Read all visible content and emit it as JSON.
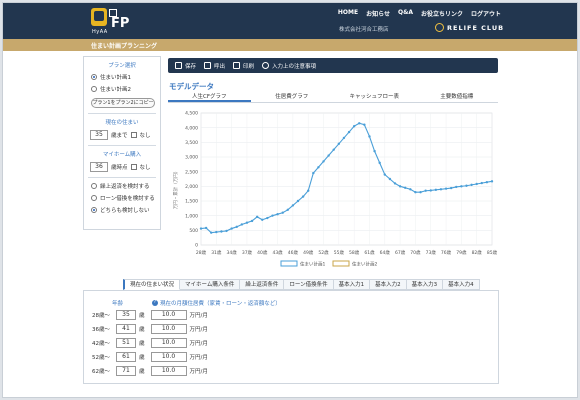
{
  "header": {
    "logo_text": "FP",
    "logo_tagline": "HyAA",
    "nav": [
      "HOME",
      "お知らせ",
      "Q&A",
      "お役立ちリンク",
      "ログアウト"
    ],
    "company": "株式会社河合工務店",
    "brand": "RELIFE CLUB"
  },
  "subbar": {
    "title": "住まい計画プランニング"
  },
  "sidebar": {
    "plan_heading": "プラン選択",
    "plans": [
      {
        "label": "住まい計画1",
        "selected": true
      },
      {
        "label": "住まい計画2",
        "selected": false
      }
    ],
    "copy_button": "プラン1をプラン2にコピー",
    "current_home_heading": "現在の住まい",
    "current_home_value": "35",
    "current_home_unit": "歳まで",
    "none_label": "なし",
    "myhome_heading": "マイホーム購入",
    "myhome_value": "36",
    "myhome_unit": "歳時点",
    "options": [
      {
        "label": "繰上返済を検討する",
        "selected": false
      },
      {
        "label": "ローン借換を検討する",
        "selected": false
      },
      {
        "label": "どちらも検討しない",
        "selected": true
      }
    ]
  },
  "toolbar": {
    "items": [
      {
        "label": "保存",
        "icon": "save-icon"
      },
      {
        "label": "呼出",
        "icon": "load-icon"
      },
      {
        "label": "印刷",
        "icon": "print-icon"
      },
      {
        "label": "入力上の注意事項",
        "icon": "info-icon"
      }
    ]
  },
  "main": {
    "title": "モデルデータ",
    "tabs": [
      "人生CFグラフ",
      "住居費グラフ",
      "キャッシュフロー表",
      "主要数値指標"
    ],
    "active_tab": 0
  },
  "chart_data": {
    "type": "line",
    "title": "",
    "ylabel": "万円・累計（万円）",
    "xlabel": "",
    "ylim": [
      0,
      4500
    ],
    "yticks": [
      0,
      500,
      1000,
      1500,
      2000,
      2500,
      3000,
      3500,
      4000,
      4500
    ],
    "xlabels": [
      "28歳",
      "31歳",
      "34歳",
      "37歳",
      "40歳",
      "43歳",
      "46歳",
      "49歳",
      "52歳",
      "55歳",
      "58歳",
      "61歳",
      "64歳",
      "67歳",
      "70歳",
      "73歳",
      "76歳",
      "79歳",
      "82歳",
      "85歳"
    ],
    "grid": true,
    "legend_position": "bottom",
    "x": [
      28,
      29,
      30,
      31,
      32,
      33,
      34,
      35,
      36,
      37,
      38,
      39,
      40,
      41,
      42,
      43,
      44,
      45,
      46,
      47,
      48,
      49,
      50,
      51,
      52,
      53,
      54,
      55,
      56,
      57,
      58,
      59,
      60,
      61,
      62,
      63,
      64,
      65,
      66,
      67,
      68,
      69,
      70,
      71,
      72,
      73,
      74,
      75,
      76,
      77,
      78,
      79,
      80,
      81,
      82,
      83,
      84,
      85
    ],
    "series": [
      {
        "name": "住まい計画1",
        "color": "#4a9fd8",
        "values": [
          560,
          580,
          420,
          440,
          460,
          480,
          560,
          620,
          700,
          760,
          820,
          960,
          860,
          920,
          1000,
          1050,
          1100,
          1200,
          1350,
          1500,
          1650,
          1850,
          2450,
          2650,
          2850,
          3050,
          3250,
          3450,
          3650,
          3850,
          4050,
          4150,
          4100,
          3700,
          3200,
          2800,
          2400,
          2250,
          2100,
          2000,
          1950,
          1900,
          1800,
          1800,
          1850,
          1860,
          1880,
          1900,
          1920,
          1940,
          1980,
          2000,
          2020,
          2050,
          2080,
          2110,
          2140,
          2170
        ]
      }
    ],
    "legend": [
      {
        "label": "住まい計画1",
        "color": "#4a9fd8"
      },
      {
        "label": "住まい計画2",
        "color": "#c9a64a"
      }
    ]
  },
  "input_panel": {
    "tabs": [
      "現在の住まい状況",
      "マイホーム購入条件",
      "繰上返済条件",
      "ローン借換条件",
      "基本入力1",
      "基本入力2",
      "基本入力3",
      "基本入力4"
    ],
    "age_header": "年齢",
    "cost_header": "現在の月額住居費（家賃・ローン・返済額など）",
    "age_unit": "歳",
    "cost_unit": "万円/月",
    "rows": [
      {
        "from": "28歳～",
        "to": "35",
        "cost": "10.0"
      },
      {
        "from": "36歳～",
        "to": "41",
        "cost": "10.0"
      },
      {
        "from": "42歳～",
        "to": "51",
        "cost": "10.0"
      },
      {
        "from": "52歳～",
        "to": "61",
        "cost": "10.0"
      },
      {
        "from": "62歳～",
        "to": "71",
        "cost": "10.0"
      }
    ]
  }
}
